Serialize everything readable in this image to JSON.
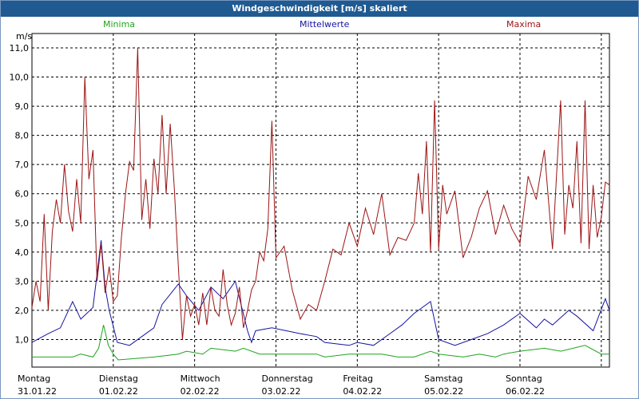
{
  "title": "Windgeschwindigkeit [m/s] skaliert",
  "colors": {
    "titlebar": "#1f5a91",
    "min": "#1fa31f",
    "mid": "#1414a0",
    "max": "#9c1414"
  },
  "chart_data": {
    "type": "line",
    "unit_label": "m/s",
    "ylim": [
      0,
      11.5
    ],
    "yticks": [
      "1,0",
      "2,0",
      "3,0",
      "4,0",
      "5,0",
      "6,0",
      "7,0",
      "8,0",
      "9,0",
      "10,0",
      "11,0"
    ],
    "xlim": [
      0,
      7.1
    ],
    "grid": true,
    "legend_placement": "top",
    "days": [
      {
        "name": "Montag",
        "date": "31.01.22"
      },
      {
        "name": "Dienstag",
        "date": "01.02.22"
      },
      {
        "name": "Mittwoch",
        "date": "02.02.22"
      },
      {
        "name": "Donnerstag",
        "date": "03.02.22"
      },
      {
        "name": "Freitag",
        "date": "04.02.22"
      },
      {
        "name": "Samstag",
        "date": "05.02.22"
      },
      {
        "name": "Sonntag",
        "date": "06.02.22"
      }
    ],
    "series": [
      {
        "name": "Minima",
        "color": "#1fa31f",
        "x": [
          0,
          0.5,
          0.6,
          0.75,
          0.82,
          0.88,
          0.94,
          1.0,
          1.06,
          1.5,
          1.8,
          1.9,
          2.1,
          2.2,
          2.5,
          2.6,
          2.8,
          2.9,
          3.3,
          3.5,
          3.6,
          3.9,
          4.0,
          4.3,
          4.5,
          4.7,
          4.9,
          5.0,
          5.3,
          5.5,
          5.7,
          5.8,
          6.0,
          6.3,
          6.5,
          6.8,
          7.0,
          7.1
        ],
        "values": [
          0.4,
          0.4,
          0.5,
          0.4,
          0.7,
          1.5,
          0.8,
          0.5,
          0.3,
          0.4,
          0.5,
          0.6,
          0.5,
          0.7,
          0.6,
          0.7,
          0.5,
          0.5,
          0.5,
          0.5,
          0.4,
          0.5,
          0.5,
          0.5,
          0.4,
          0.4,
          0.6,
          0.5,
          0.4,
          0.5,
          0.4,
          0.5,
          0.6,
          0.7,
          0.6,
          0.8,
          0.5,
          0.5
        ]
      },
      {
        "name": "Mittelwerte",
        "color": "#1414a0",
        "x": [
          0,
          0.2,
          0.35,
          0.5,
          0.6,
          0.75,
          0.85,
          0.9,
          0.95,
          1.05,
          1.2,
          1.5,
          1.6,
          1.8,
          1.9,
          2.05,
          2.2,
          2.35,
          2.5,
          2.65,
          2.7,
          2.75,
          2.95,
          3.3,
          3.5,
          3.6,
          3.9,
          4.0,
          4.2,
          4.4,
          4.55,
          4.7,
          4.9,
          5.0,
          5.2,
          5.4,
          5.6,
          5.8,
          6.0,
          6.2,
          6.3,
          6.4,
          6.6,
          6.7,
          6.9,
          7.05,
          7.1
        ],
        "values": [
          0.9,
          1.2,
          1.4,
          2.3,
          1.7,
          2.1,
          4.4,
          2.8,
          2.0,
          0.9,
          0.8,
          1.4,
          2.2,
          2.9,
          2.5,
          2.0,
          2.8,
          2.4,
          3.0,
          1.3,
          0.9,
          1.3,
          1.4,
          1.2,
          1.1,
          0.9,
          0.8,
          0.9,
          0.8,
          1.2,
          1.5,
          1.9,
          2.3,
          1.0,
          0.8,
          1.0,
          1.2,
          1.5,
          1.9,
          1.4,
          1.7,
          1.5,
          2.0,
          1.8,
          1.3,
          2.4,
          2.0
        ]
      },
      {
        "name": "Maxima",
        "color": "#9c1414",
        "x": [
          0,
          0.05,
          0.1,
          0.15,
          0.2,
          0.25,
          0.3,
          0.35,
          0.4,
          0.45,
          0.5,
          0.55,
          0.6,
          0.65,
          0.7,
          0.75,
          0.8,
          0.85,
          0.9,
          0.95,
          1.0,
          1.05,
          1.1,
          1.15,
          1.2,
          1.25,
          1.3,
          1.35,
          1.4,
          1.45,
          1.5,
          1.55,
          1.6,
          1.65,
          1.7,
          1.75,
          1.8,
          1.85,
          1.9,
          1.95,
          2.0,
          2.05,
          2.1,
          2.15,
          2.2,
          2.25,
          2.3,
          2.35,
          2.4,
          2.45,
          2.5,
          2.55,
          2.6,
          2.65,
          2.7,
          2.75,
          2.8,
          2.85,
          2.9,
          2.95,
          3.0,
          3.1,
          3.2,
          3.3,
          3.4,
          3.5,
          3.6,
          3.7,
          3.8,
          3.9,
          4.0,
          4.1,
          4.2,
          4.3,
          4.4,
          4.5,
          4.6,
          4.7,
          4.75,
          4.8,
          4.85,
          4.9,
          4.95,
          5.0,
          5.05,
          5.1,
          5.2,
          5.3,
          5.4,
          5.5,
          5.6,
          5.7,
          5.8,
          5.9,
          6.0,
          6.1,
          6.2,
          6.3,
          6.4,
          6.5,
          6.55,
          6.6,
          6.65,
          6.7,
          6.75,
          6.8,
          6.85,
          6.9,
          6.95,
          7.0,
          7.05,
          7.1
        ],
        "values": [
          2.1,
          3.0,
          2.3,
          5.3,
          2.0,
          4.7,
          5.8,
          5.0,
          7.0,
          5.4,
          4.7,
          6.5,
          5.0,
          10.0,
          6.5,
          7.5,
          3.0,
          4.3,
          2.6,
          3.5,
          2.3,
          2.5,
          4.5,
          6.0,
          7.1,
          6.8,
          11.0,
          5.1,
          6.5,
          4.8,
          7.2,
          6.0,
          8.7,
          6.0,
          8.4,
          6.2,
          3.5,
          1.0,
          2.5,
          1.8,
          2.2,
          1.5,
          2.6,
          1.5,
          2.8,
          2.0,
          1.8,
          3.4,
          2.2,
          1.5,
          1.9,
          2.8,
          1.4,
          2.0,
          2.7,
          3.0,
          4.0,
          3.7,
          4.8,
          8.5,
          3.8,
          4.2,
          2.7,
          1.7,
          2.2,
          2.0,
          3.0,
          4.1,
          3.9,
          5.0,
          4.2,
          5.5,
          4.6,
          6.0,
          3.9,
          4.5,
          4.4,
          5.0,
          6.7,
          5.3,
          7.8,
          4.0,
          9.2,
          4.1,
          6.3,
          5.3,
          6.1,
          3.8,
          4.5,
          5.5,
          6.1,
          4.6,
          5.6,
          4.8,
          4.3,
          6.6,
          5.8,
          7.5,
          4.1,
          9.2,
          4.6,
          6.3,
          5.5,
          7.8,
          4.3,
          9.2,
          4.1,
          6.3,
          4.5,
          5.2,
          6.4,
          6.3
        ]
      }
    ]
  }
}
